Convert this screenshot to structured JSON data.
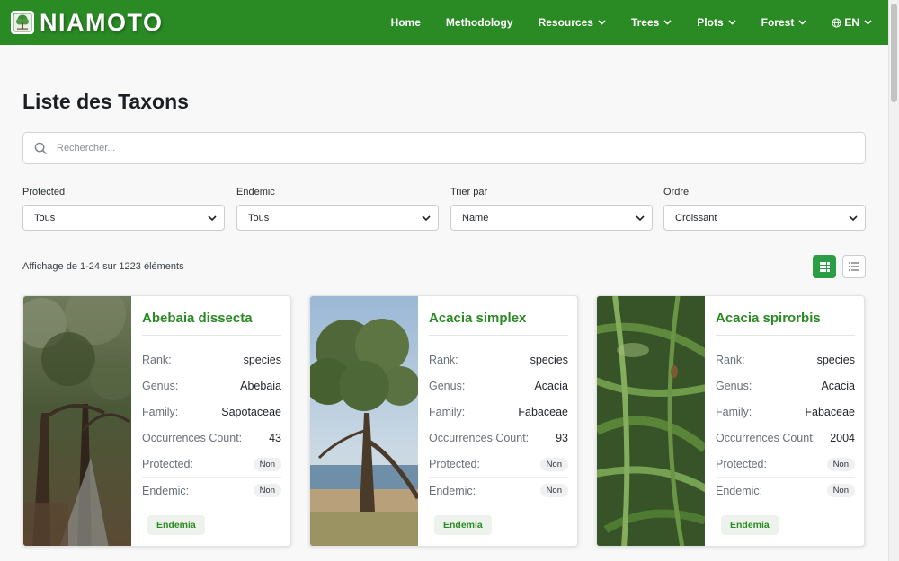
{
  "brand": {
    "name": "NIAMOTO"
  },
  "nav": {
    "items": [
      {
        "label": "Home",
        "dropdown": false
      },
      {
        "label": "Methodology",
        "dropdown": false
      },
      {
        "label": "Resources",
        "dropdown": true
      },
      {
        "label": "Trees",
        "dropdown": true
      },
      {
        "label": "Plots",
        "dropdown": true
      },
      {
        "label": "Forest",
        "dropdown": true
      }
    ],
    "language": "EN"
  },
  "page": {
    "title": "Liste des Taxons"
  },
  "search": {
    "placeholder": "Rechercher..."
  },
  "filters": [
    {
      "label": "Protected",
      "value": "Tous"
    },
    {
      "label": "Endemic",
      "value": "Tous"
    },
    {
      "label": "Trier par",
      "value": "Name"
    },
    {
      "label": "Ordre",
      "value": "Croissant"
    }
  ],
  "results": {
    "summary": "Affichage de 1-24 sur 1223 éléments"
  },
  "field_labels": {
    "rank": "Rank:",
    "genus": "Genus:",
    "family": "Family:",
    "occurrences": "Occurrences Count:",
    "protected": "Protected:",
    "endemic": "Endemic:"
  },
  "cards": [
    {
      "title": "Abebaia dissecta",
      "rank": "species",
      "genus": "Abebaia",
      "family": "Sapotaceae",
      "occurrences": "43",
      "protected": "Non",
      "endemic": "Non",
      "tag": "Endemia"
    },
    {
      "title": "Acacia simplex",
      "rank": "species",
      "genus": "Acacia",
      "family": "Fabaceae",
      "occurrences": "93",
      "protected": "Non",
      "endemic": "Non",
      "tag": "Endemia"
    },
    {
      "title": "Acacia spirorbis",
      "rank": "species",
      "genus": "Acacia",
      "family": "Fabaceae",
      "occurrences": "2004",
      "protected": "Non",
      "endemic": "Non",
      "tag": "Endemia"
    }
  ],
  "colors": {
    "primary": "#2a8a24",
    "active_view": "#2a9d45"
  }
}
